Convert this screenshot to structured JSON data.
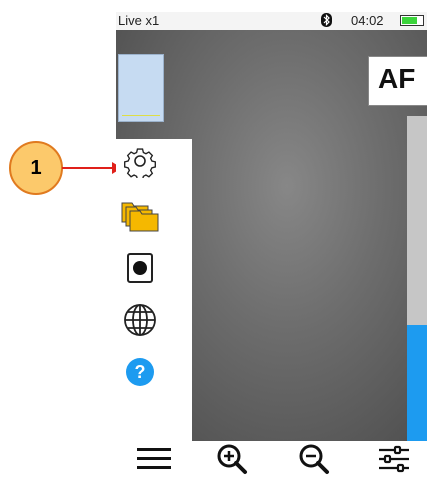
{
  "callout": {
    "number": "1"
  },
  "status_bar": {
    "mode": "Live x1",
    "time": "04:02",
    "battery_level": 0.75,
    "bluetooth": "bluetooth-icon"
  },
  "camera_view": {
    "af_label": "AF",
    "level_fraction": 0.36
  },
  "sidebar": {
    "items": [
      {
        "icon": "gear-icon"
      },
      {
        "icon": "folders-icon"
      },
      {
        "icon": "record-icon"
      },
      {
        "icon": "globe-icon"
      },
      {
        "icon": "help-icon",
        "glyph": "?"
      }
    ]
  },
  "bottom_bar": {
    "items": [
      {
        "icon": "menu-icon"
      },
      {
        "icon": "zoom-in-icon"
      },
      {
        "icon": "zoom-out-icon"
      },
      {
        "icon": "sliders-icon"
      }
    ]
  },
  "colors": {
    "callout_fill": "#fcc96b",
    "callout_border": "#e07a1f",
    "arrow": "#e0201a",
    "level": "#1d9bf0",
    "battery": "#3bd43b",
    "folder": "#f5b800"
  }
}
